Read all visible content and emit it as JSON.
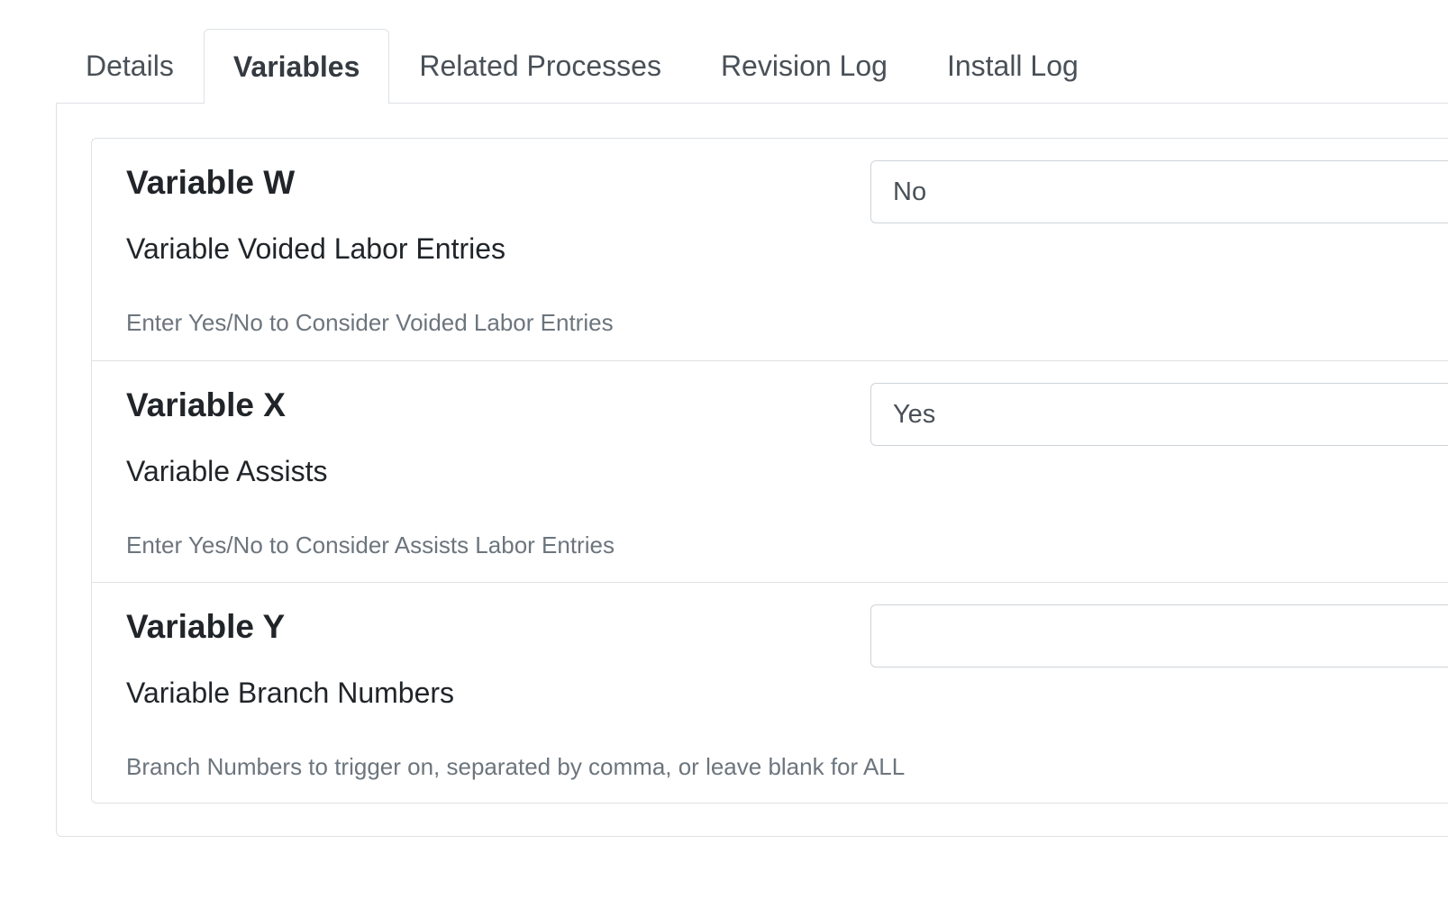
{
  "tabs": [
    {
      "label": "Details",
      "active": false
    },
    {
      "label": "Variables",
      "active": true
    },
    {
      "label": "Related Processes",
      "active": false
    },
    {
      "label": "Revision Log",
      "active": false
    },
    {
      "label": "Install Log",
      "active": false
    }
  ],
  "variables": [
    {
      "name": "Variable W",
      "label": "Variable Voided Labor Entries",
      "help": "Enter Yes/No to Consider Voided Labor Entries",
      "value": "No"
    },
    {
      "name": "Variable X",
      "label": "Variable Assists",
      "help": "Enter Yes/No to Consider Assists Labor Entries",
      "value": "Yes"
    },
    {
      "name": "Variable Y",
      "label": "Variable Branch Numbers",
      "help": "Branch Numbers to trigger on, separated by comma, or leave blank for ALL",
      "value": ""
    }
  ]
}
